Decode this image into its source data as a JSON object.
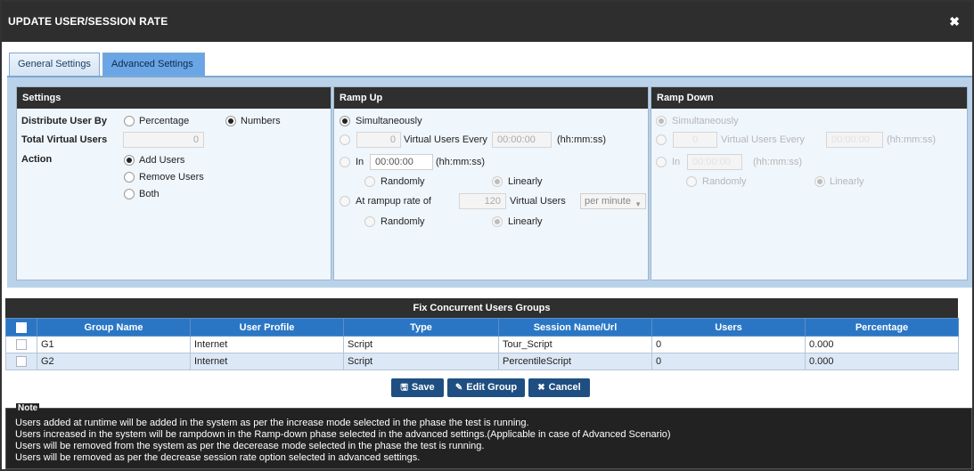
{
  "dialog": {
    "title": "UPDATE USER/SESSION RATE",
    "close_glyph": "✖"
  },
  "tabs": [
    {
      "label": "General Settings",
      "active": false
    },
    {
      "label": "Advanced Settings",
      "active": true
    }
  ],
  "settings": {
    "header": "Settings",
    "distribute_label": "Distribute User By",
    "options": {
      "percentage": "Percentage",
      "numbers": "Numbers",
      "selected": "Numbers"
    },
    "total_label": "Total Virtual Users",
    "total_value": "0",
    "action_label": "Action",
    "actions": {
      "add": "Add Users",
      "remove": "Remove Users",
      "both": "Both",
      "selected": "Add Users"
    }
  },
  "rampup": {
    "header": "Ramp Up",
    "simultaneously": "Simultaneously",
    "users_value": "0",
    "users_every": "Virtual Users Every",
    "time_value": "00:00:00",
    "time_format": "(hh:mm:ss)",
    "in_label": "In",
    "in_time": "00:00:00",
    "randomly": "Randomly",
    "linearly": "Linearly",
    "rate_label": "At rampup rate of",
    "rate_value": "120",
    "rate_unit": "Virtual Users",
    "rate_period": "per minute",
    "selected": "Simultaneously"
  },
  "rampdown": {
    "header": "Ramp Down",
    "simultaneously": "Simultaneously",
    "users_value": "0",
    "users_every": "Virtual Users Every",
    "time_value": "00:00:00",
    "time_format": "(hh:mm:ss)",
    "in_label": "In",
    "in_time": "00:00:00",
    "randomly": "Randomly",
    "linearly": "Linearly"
  },
  "grid": {
    "title": "Fix Concurrent Users Groups",
    "columns": [
      "Group Name",
      "User Profile",
      "Type",
      "Session Name/Url",
      "Users",
      "Percentage"
    ],
    "rows": [
      [
        "G1",
        "Internet",
        "Script",
        "Tour_Script",
        "0",
        "0.000"
      ],
      [
        "G2",
        "Internet",
        "Script",
        "PercentileScript",
        "0",
        "0.000"
      ]
    ]
  },
  "buttons": {
    "save": "Save",
    "edit_group": "Edit Group",
    "cancel": "Cancel"
  },
  "note": {
    "legend": "Note",
    "lines": [
      "Users added at runtime will be added in the system as per the increase mode selected in the phase the test is running.",
      "Users increased in the system will be rampdown in the Ramp-down phase selected in the advanced settings.(Applicable in case of Advanced Scenario)",
      "Users will be removed from the system as per the decerease mode selected in the phase the test is running.",
      "Users will be removed as per the decrease session rate option selected in advanced settings."
    ]
  },
  "colors": {
    "titlebar": "#2e2e2e",
    "grid_header": "#2a76c4",
    "button": "#1f4f82",
    "active_tab": "#6aa6e6"
  }
}
